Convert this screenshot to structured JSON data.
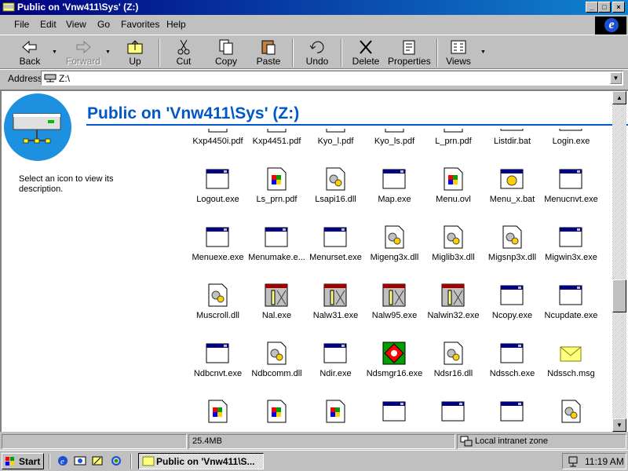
{
  "window": {
    "title": "Public on 'Vnw411\\Sys' (Z:)",
    "controls": {
      "minimize": "_",
      "maximize": "□",
      "close": "×"
    }
  },
  "menu": [
    "File",
    "Edit",
    "View",
    "Go",
    "Favorites",
    "Help"
  ],
  "toolbar": {
    "back": "Back",
    "forward": "Forward",
    "up": "Up",
    "cut": "Cut",
    "copy": "Copy",
    "paste": "Paste",
    "undo": "Undo",
    "delete": "Delete",
    "properties": "Properties",
    "views": "Views"
  },
  "address": {
    "label": "Address",
    "value": "Z:\\"
  },
  "folder": {
    "title": "Public on 'Vnw411\\Sys' (Z:)",
    "info": "Select an icon to view its description."
  },
  "files": [
    {
      "name": "Kxp4450i.pdf",
      "icon": "pdf-icon"
    },
    {
      "name": "Kxp4451.pdf",
      "icon": "pdf-icon"
    },
    {
      "name": "Kyo_l.pdf",
      "icon": "pdf-icon"
    },
    {
      "name": "Kyo_ls.pdf",
      "icon": "pdf-icon"
    },
    {
      "name": "L_prn.pdf",
      "icon": "pdf-icon"
    },
    {
      "name": "Listdir.bat",
      "icon": "batch-icon"
    },
    {
      "name": "Login.exe",
      "icon": "exe-icon"
    },
    {
      "name": "Logout.exe",
      "icon": "exe-icon"
    },
    {
      "name": "Ls_prn.pdf",
      "icon": "pdf-icon"
    },
    {
      "name": "Lsapi16.dll",
      "icon": "dll-icon"
    },
    {
      "name": "Map.exe",
      "icon": "exe-icon"
    },
    {
      "name": "Menu.ovl",
      "icon": "pdf-icon"
    },
    {
      "name": "Menu_x.bat",
      "icon": "batch-icon"
    },
    {
      "name": "Menucnvt.exe",
      "icon": "exe-icon"
    },
    {
      "name": "Menuexe.exe",
      "icon": "exe-icon"
    },
    {
      "name": "Menumake.e...",
      "icon": "exe-icon"
    },
    {
      "name": "Menurset.exe",
      "icon": "exe-icon"
    },
    {
      "name": "Migeng3x.dll",
      "icon": "dll-icon"
    },
    {
      "name": "Miglib3x.dll",
      "icon": "dll-icon"
    },
    {
      "name": "Migsnp3x.dll",
      "icon": "dll-icon"
    },
    {
      "name": "Migwin3x.exe",
      "icon": "exe-icon"
    },
    {
      "name": "Muscroll.dll",
      "icon": "dll-icon"
    },
    {
      "name": "Nal.exe",
      "icon": "nal-icon"
    },
    {
      "name": "Nalw31.exe",
      "icon": "nal-icon"
    },
    {
      "name": "Nalw95.exe",
      "icon": "nal-icon"
    },
    {
      "name": "Nalwin32.exe",
      "icon": "nal-icon"
    },
    {
      "name": "Ncopy.exe",
      "icon": "exe-icon"
    },
    {
      "name": "Ncupdate.exe",
      "icon": "exe-icon"
    },
    {
      "name": "Ndbcnvt.exe",
      "icon": "exe-icon"
    },
    {
      "name": "Ndbcomm.dll",
      "icon": "dll-icon"
    },
    {
      "name": "Ndir.exe",
      "icon": "exe-icon"
    },
    {
      "name": "Ndsmgr16.exe",
      "icon": "ndsmgr-icon"
    },
    {
      "name": "Ndsr16.dll",
      "icon": "dll-icon"
    },
    {
      "name": "Ndssch.exe",
      "icon": "exe-icon"
    },
    {
      "name": "Ndssch.msg",
      "icon": "msg-icon"
    },
    {
      "name": "",
      "icon": "pdf-icon"
    },
    {
      "name": "",
      "icon": "pdf-icon"
    },
    {
      "name": "",
      "icon": "pdf-icon"
    },
    {
      "name": "",
      "icon": "exe-icon"
    },
    {
      "name": "",
      "icon": "exe-icon"
    },
    {
      "name": "",
      "icon": "exe-icon"
    },
    {
      "name": "",
      "icon": "dll-icon"
    }
  ],
  "status": {
    "size": "25.4MB",
    "zone": "Local intranet zone"
  },
  "taskbar": {
    "start": "Start",
    "window": "Public on 'Vnw411\\S...",
    "clock": "11:19 AM"
  },
  "colors": {
    "titlebar_start": "#000080",
    "titlebar_end": "#1084d0",
    "folder_title": "#0058c8",
    "folder_badge": "#1e90e0"
  }
}
